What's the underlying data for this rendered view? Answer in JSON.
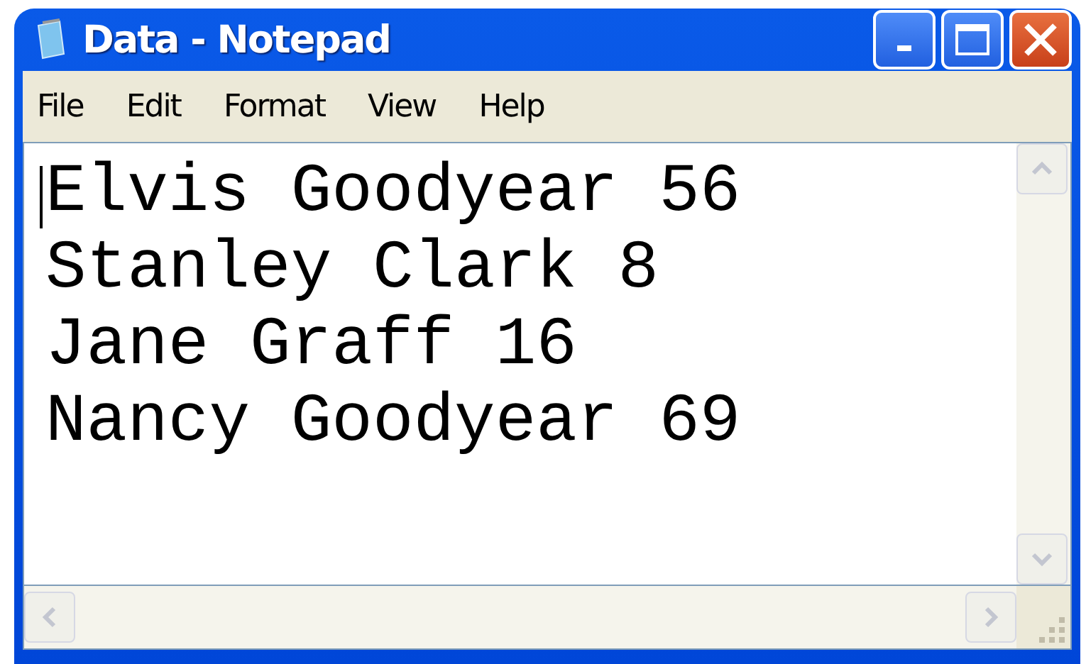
{
  "window": {
    "title": "Data - Notepad"
  },
  "menu": [
    "File",
    "Edit",
    "Format",
    "View",
    "Help"
  ],
  "document": {
    "lines": [
      "Elvis Goodyear 56",
      "Stanley Clark 8",
      "Jane Graff 16",
      "Nancy Goodyear 69"
    ]
  }
}
